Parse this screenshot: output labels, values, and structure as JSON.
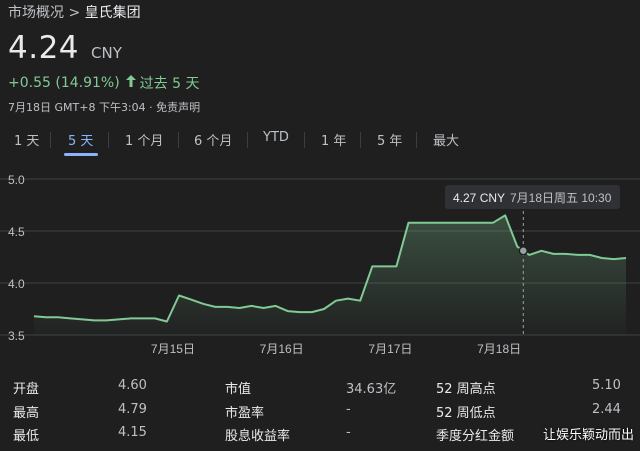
{
  "breadcrumb": {
    "parent": "市场概况",
    "separator": ">",
    "current": "皇氏集团"
  },
  "quote": {
    "price": "4.24",
    "currency": "CNY",
    "change": "+0.55 (14.91%)",
    "change_period": "过去 5 天",
    "timestamp": "7月18日 GMT+8 下午3:04 · 免责声明"
  },
  "tabs": [
    {
      "label": "1 天"
    },
    {
      "label": "5 天",
      "active": true
    },
    {
      "label": "1 个月"
    },
    {
      "label": "6 个月"
    },
    {
      "label": "YTD"
    },
    {
      "label": "1 年"
    },
    {
      "label": "5 年"
    },
    {
      "label": "最大"
    }
  ],
  "colors": {
    "line": "#81c995",
    "accent": "#8ab4f8",
    "text": "#e8eaed",
    "muted": "#bdc1c6",
    "background": "#1f1f1f"
  },
  "tooltip": {
    "price": "4.27 CNY",
    "time": "7月18日周五 10:30"
  },
  "chart_data": {
    "type": "line",
    "ylim": [
      3.5,
      5.0
    ],
    "y_ticks": [
      "5.0",
      "4.5",
      "4.0",
      "3.5"
    ],
    "y_tick_values": [
      5.0,
      4.5,
      4.0,
      3.5
    ],
    "x_ticks": [
      "7月15日",
      "7月16日",
      "7月17日",
      "7月18日"
    ],
    "x_tick_index": [
      11.5,
      20.5,
      29.5,
      38.5
    ],
    "hover_index": 40.5,
    "series": [
      {
        "values": [
          3.68,
          3.67,
          3.67,
          3.66,
          3.65,
          3.64,
          3.64,
          3.65,
          3.66,
          3.66,
          3.66,
          3.63,
          3.88,
          3.84,
          3.8,
          3.77,
          3.77,
          3.76,
          3.78,
          3.76,
          3.78,
          3.73,
          3.72,
          3.72,
          3.75,
          3.83,
          3.85,
          3.83,
          4.16,
          4.16,
          4.16,
          4.58,
          4.58,
          4.58,
          4.58,
          4.58,
          4.58,
          4.58,
          4.58,
          4.65,
          4.35,
          4.27,
          4.31,
          4.28,
          4.28,
          4.27,
          4.27,
          4.24,
          4.23,
          4.24
        ]
      }
    ]
  },
  "stats": {
    "col1": [
      {
        "label": "开盘",
        "value": "4.60"
      },
      {
        "label": "最高",
        "value": "4.79"
      },
      {
        "label": "最低",
        "value": "4.15"
      }
    ],
    "col2": [
      {
        "label": "市值",
        "value": "34.63亿"
      },
      {
        "label": "市盈率",
        "value": "-"
      },
      {
        "label": "股息收益率",
        "value": "-"
      }
    ],
    "col3": [
      {
        "label": "52 周高点",
        "value": "5.10"
      },
      {
        "label": "52 周低点",
        "value": "2.44"
      },
      {
        "label": "季度分红金额",
        "value": ""
      }
    ]
  },
  "watermark": "让娱乐颖动而出"
}
